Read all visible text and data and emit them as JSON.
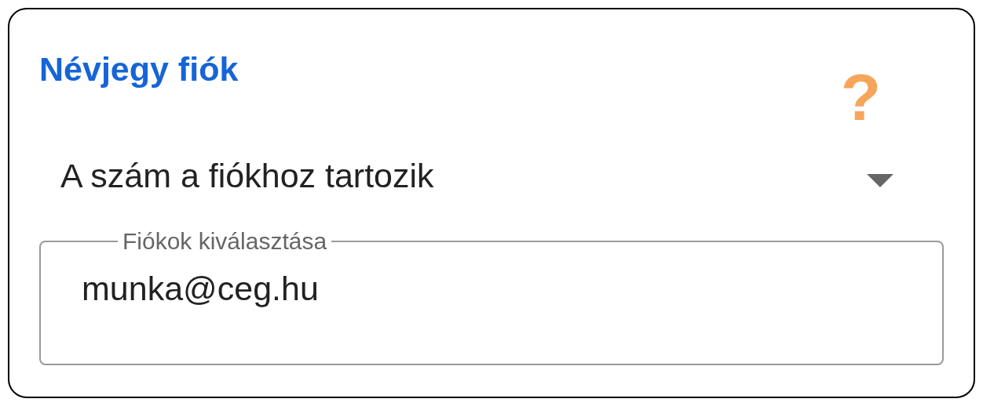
{
  "card": {
    "title": "Névjegy fiók",
    "help": "?"
  },
  "dropdown": {
    "value": "A szám a fiókhoz tartozik"
  },
  "account_field": {
    "label": "Fiókok kiválasztása",
    "value": "munka@ceg.hu"
  }
}
